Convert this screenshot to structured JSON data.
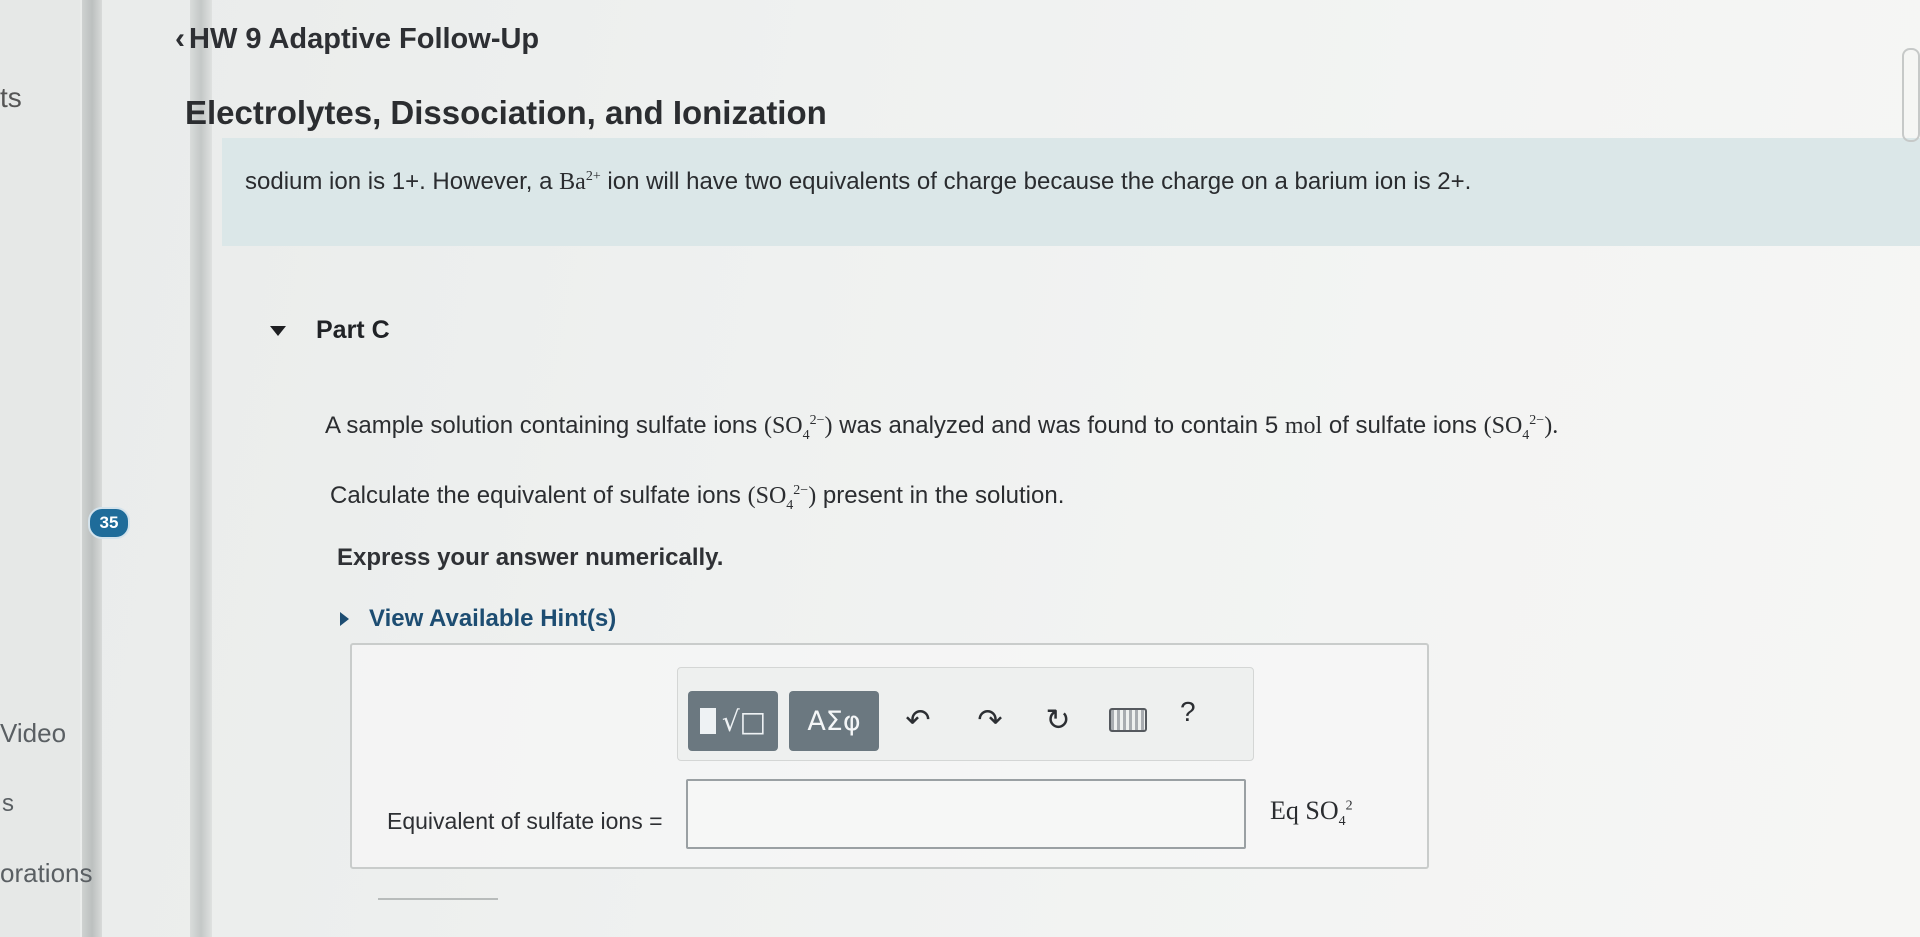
{
  "nav": {
    "top_fragment": "ts",
    "badge": "35",
    "video": "Video",
    "s_item": "s",
    "orations": "orations"
  },
  "header": {
    "back_label": "HW 9 Adaptive Follow-Up",
    "title": "Electrolytes, Dissociation, and Ionization"
  },
  "intro": {
    "part1": "sodium ion is 1+. However, a ",
    "ion": "Ba",
    "ion_charge": "2+",
    "part2": " ion will have two equivalents of charge because the charge on a barium ion is 2+."
  },
  "part": {
    "label": "Part C"
  },
  "question": {
    "line1_a": "A sample solution containing sulfate ions ",
    "formula": "SO",
    "formula_sub": "4",
    "formula_sup": "2−",
    "line1_b": " was analyzed and was found to contain 5 ",
    "unit_mol": "mol",
    "line1_c": " of sulfate ions ",
    "line2_a": "Calculate the equivalent of sulfate ions ",
    "line2_b": " present in the solution.",
    "instruction": "Express your answer numerically."
  },
  "hint": {
    "label": "View Available Hint(s)"
  },
  "toolbar": {
    "templates": "√□",
    "greek": "ΑΣφ",
    "undo": "↶",
    "redo": "↷",
    "reset": "↻",
    "help": "?"
  },
  "answer": {
    "label": "Equivalent of sulfate ions =",
    "value": "",
    "unit_prefix": "Eq SO",
    "unit_sub": "4",
    "unit_sup": "2"
  }
}
